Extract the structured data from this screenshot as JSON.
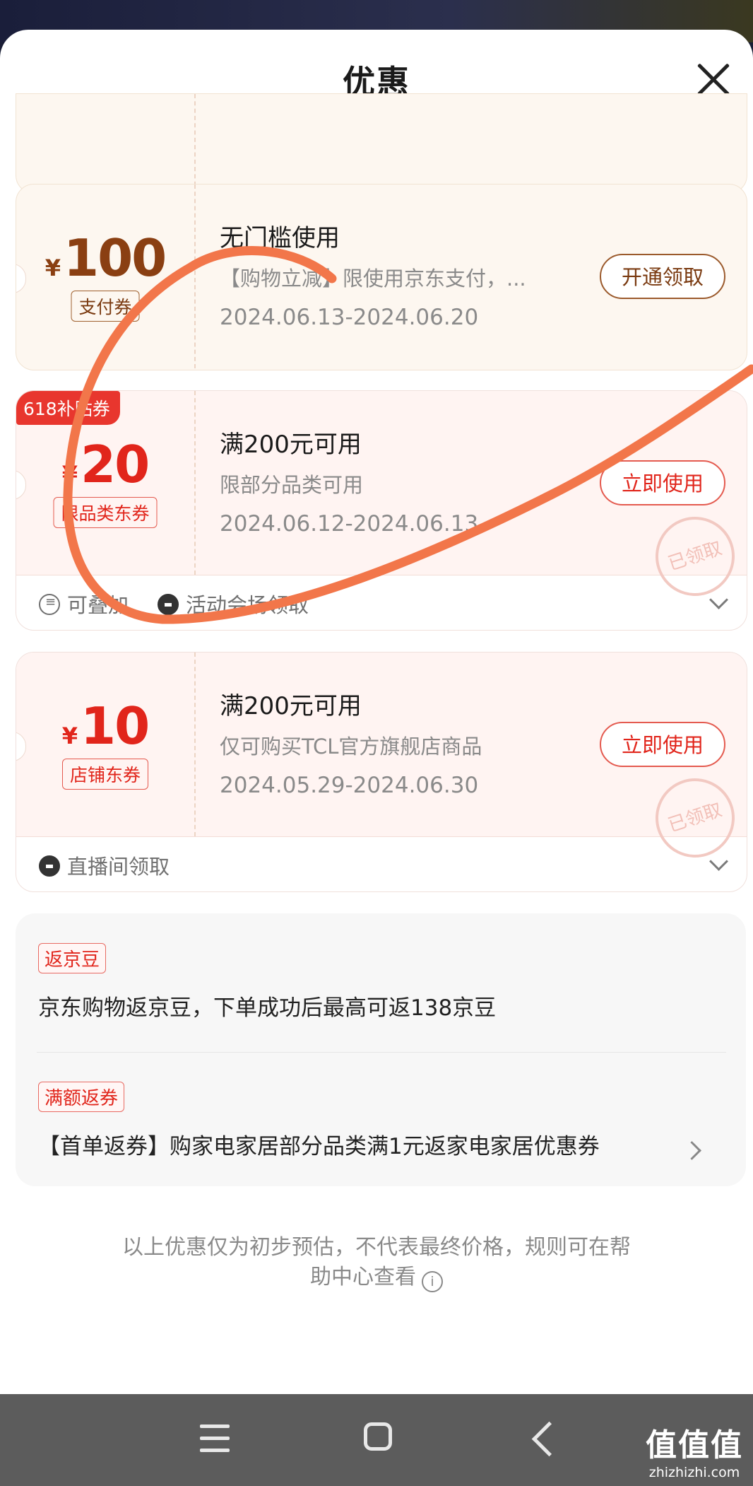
{
  "header": {
    "title": "优惠"
  },
  "coupons": [
    {
      "currency": "¥",
      "amount": "100",
      "tag": "支付券",
      "title": "无门槛使用",
      "desc": "【购物立减】限使用京东支付，...",
      "date": "2024.06.13-2024.06.20",
      "button": "开通领取"
    },
    {
      "ribbon": "618补贴券",
      "currency": "¥",
      "amount": "20",
      "tag": "限品类东券",
      "title": "满200元可用",
      "desc": "限部分品类可用",
      "date": "2024.06.12-2024.06.13",
      "button": "立即使用",
      "stamp": "已领取",
      "footer": [
        "可叠加",
        "活动会场领取"
      ]
    },
    {
      "currency": "¥",
      "amount": "10",
      "tag": "店铺东券",
      "title": "满200元可用",
      "desc": "仅可购买TCL官方旗舰店商品",
      "date": "2024.05.29-2024.06.30",
      "button": "立即使用",
      "stamp": "已领取",
      "footer": [
        "直播间领取"
      ]
    }
  ],
  "rebates": [
    {
      "tag": "返京豆",
      "text": "京东购物返京豆，下单成功后最高可返138京豆"
    },
    {
      "tag": "满额返券",
      "text": "【首单返券】购家电家居部分品类满1元返家电家居优惠券"
    }
  ],
  "notice": {
    "line1": "以上优惠仅为初步预估，不代表最终价格，规则可在帮",
    "line2": "助中心查看"
  },
  "watermark": {
    "logo": "值值值",
    "url": "zhizhizhi.com"
  },
  "colors": {
    "accent_red": "#e1251b",
    "brown": "#8a3f12",
    "annotation_stroke": "#f2764a"
  }
}
